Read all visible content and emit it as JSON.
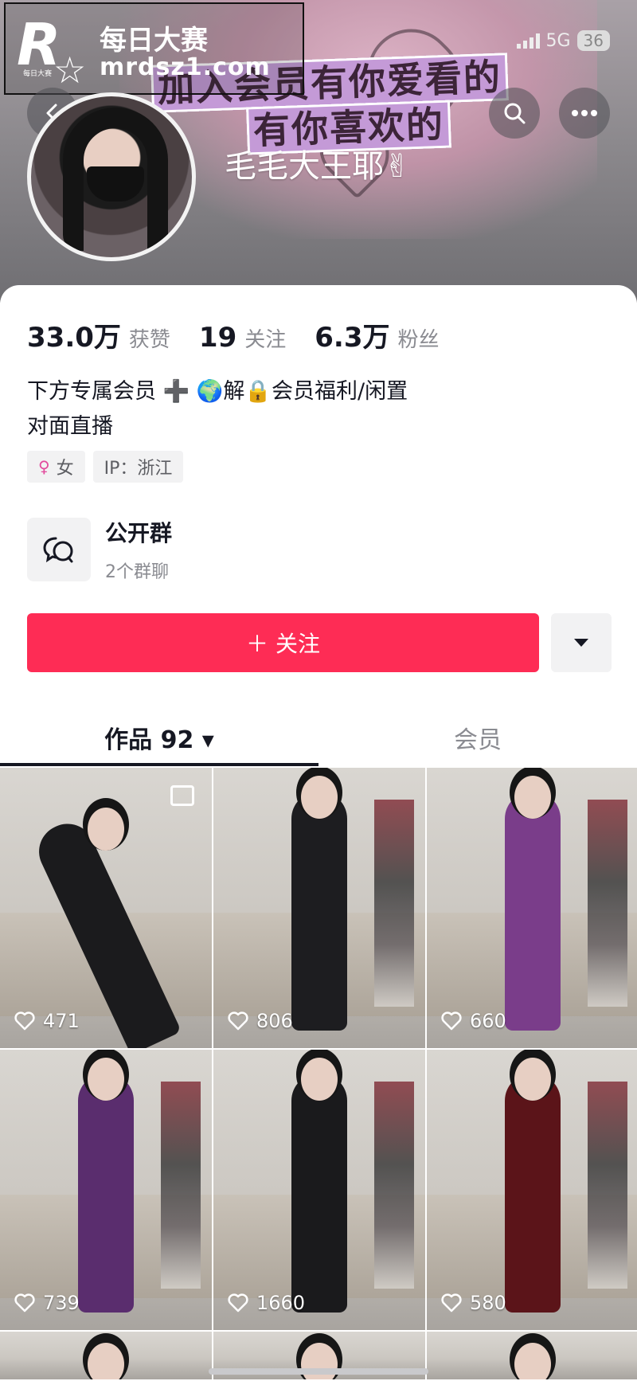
{
  "banner": {
    "line1": "加入会员有你爱看的",
    "line2": "有你喜欢的"
  },
  "watermark": {
    "logo_letter": "R",
    "logo_small": "每日大赛",
    "title": "每日大赛",
    "url": "mrdsz1.com"
  },
  "status": {
    "network": "5G",
    "battery": "36"
  },
  "profile": {
    "name": "毛毛大王耶✌",
    "stats": [
      {
        "value": "33.0万",
        "label": "获赞"
      },
      {
        "value": "19",
        "label": "关注"
      },
      {
        "value": "6.3万",
        "label": "粉丝"
      }
    ],
    "bio_line1": "下方专属会员 ➕ 🌍解🔒会员福利/闲置",
    "bio_line2": "对面直播",
    "tags": [
      {
        "icon": "♀",
        "label": "女"
      },
      {
        "icon": "",
        "label": "IP：浙江"
      }
    ]
  },
  "group": {
    "title": "公开群",
    "subtitle": "2个群聊"
  },
  "actions": {
    "follow_label": "＋ 关注"
  },
  "tabs": [
    {
      "label": "作品 92 ▾"
    },
    {
      "label": "会员"
    }
  ],
  "videos": [
    {
      "likes": "471",
      "outfit": "#1b1b1d"
    },
    {
      "likes": "806",
      "outfit": "#1d1d20"
    },
    {
      "likes": "660",
      "outfit": "#7a3d8a"
    },
    {
      "likes": "739",
      "outfit": "#5a2d6e"
    },
    {
      "likes": "1660",
      "outfit": "#1a1a1c"
    },
    {
      "likes": "580",
      "outfit": "#5b1419"
    }
  ]
}
